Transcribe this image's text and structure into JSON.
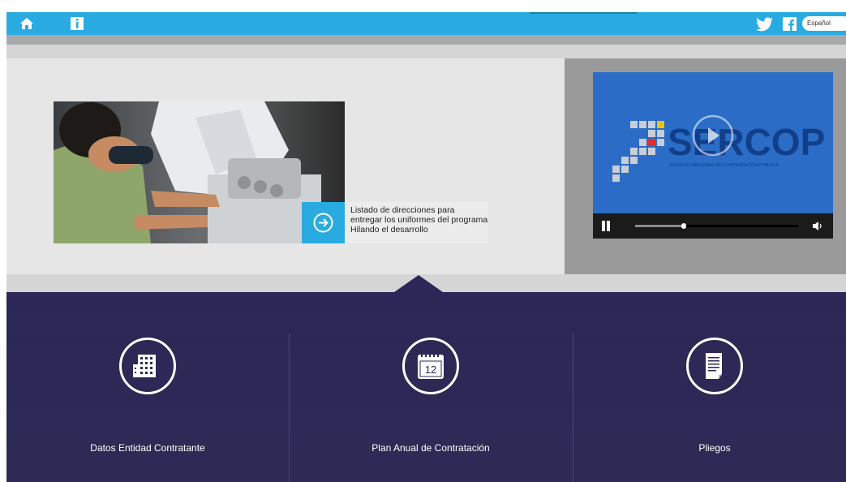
{
  "header": {
    "language": "Español",
    "icons": [
      "home-icon",
      "info-icon",
      "twitter-icon",
      "facebook-icon"
    ]
  },
  "hero": {
    "caption": "Listado de direcciones para entregar los uniformes del programa Hilando el desarrollo"
  },
  "video": {
    "brand": "SERCOP",
    "tagline": "SERVICIO NACIONAL DE CONTRATACIÓN PÚBLICA",
    "progress": 0.3
  },
  "tiles": [
    {
      "label": "Datos Entidad Contratante",
      "icon": "building-icon"
    },
    {
      "label": "Plan Anual de Contratación",
      "icon": "calendar-icon",
      "calendar_day": "12"
    },
    {
      "label": "Pliegos",
      "icon": "document-icon"
    }
  ],
  "colors": {
    "topbar": "#29abe2",
    "panel": "#2c2757",
    "accent": "#29abe2"
  }
}
